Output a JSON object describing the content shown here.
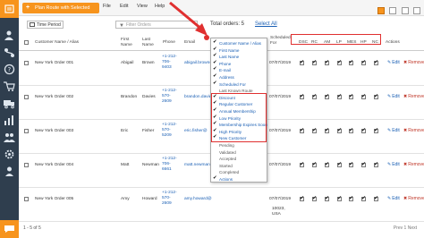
{
  "topbar": {
    "plan_button": "Plan Route with Selected",
    "menu": [
      "File",
      "Edit",
      "View",
      "Help"
    ]
  },
  "toolbar": {
    "time_period": "Time Period",
    "filter_placeholder": "Filter Orders",
    "total_orders": "Total orders: 5",
    "select_all": "Select All"
  },
  "table": {
    "headers": {
      "customer": "Customer Name / Alias",
      "first": "First Name",
      "last": "Last Name",
      "phone": "Phone",
      "email": "Email",
      "address": "Address",
      "scheduled": "Scheduled For",
      "actions": "Actions"
    },
    "flag_columns": [
      "DSC",
      "RC",
      "AM",
      "LP",
      "MES",
      "HP",
      "NC"
    ],
    "edit_label": "Edit",
    "remove_label": "Remove",
    "rows": [
      {
        "name": "New York Order 001",
        "first": "Abigail",
        "last": "Brown",
        "phone": "+1-212-706-9403",
        "email": "abigail.brown@",
        "scheduled": "07/07/2019",
        "flags": [
          true,
          true,
          true,
          true,
          true,
          true,
          true
        ]
      },
      {
        "name": "New York Order 002",
        "first": "Brandon",
        "last": "Davies",
        "phone": "+1-212-570-2609",
        "email": "brandon.davies@",
        "scheduled": "07/07/2019",
        "flags": [
          true,
          true,
          true,
          true,
          true,
          true,
          true
        ]
      },
      {
        "name": "New York Order 003",
        "first": "Eric",
        "last": "Fisher",
        "phone": "+1-212-570-5209",
        "email": "eric.fisher@",
        "scheduled": "07/07/2019",
        "flags": [
          true,
          true,
          true,
          true,
          true,
          true,
          true
        ]
      },
      {
        "name": "New York Order 004",
        "first": "Matt",
        "last": "Newman",
        "phone": "+1-212-706-6661",
        "email": "matt.newman@",
        "scheduled": "07/07/2019",
        "flags": [
          true,
          true,
          true,
          true,
          true,
          true,
          true
        ]
      },
      {
        "name": "New York Order 005",
        "first": "Amy",
        "last": "Howard",
        "phone": "+1-212-570-2609",
        "email": "amy.howard@",
        "scheduled": "07/07/2019",
        "address_tail": "10023, USA",
        "flags": [
          true,
          true,
          true,
          true,
          true,
          true,
          true
        ]
      }
    ]
  },
  "dropdown": {
    "items": [
      {
        "label": "Customer Name / Alias",
        "checked": true
      },
      {
        "label": "First Name",
        "checked": true
      },
      {
        "label": "Last Name",
        "checked": true
      },
      {
        "label": "Phone",
        "checked": true
      },
      {
        "label": "E-mail",
        "checked": true
      },
      {
        "label": "Address",
        "checked": true
      },
      {
        "label": "Scheduled For",
        "checked": true
      },
      {
        "label": "Last Known Route",
        "checked": false
      },
      {
        "label": "Discount",
        "checked": true
      },
      {
        "label": "Regular Customer",
        "checked": true
      },
      {
        "label": "Annual Membership",
        "checked": true
      },
      {
        "label": "Low Priority",
        "checked": true
      },
      {
        "label": "Membership Expires Soon",
        "checked": true
      },
      {
        "label": "High Priority",
        "checked": true
      },
      {
        "label": "New Customer",
        "checked": true
      },
      {
        "label": "Pending",
        "checked": false
      },
      {
        "label": "Validated",
        "checked": false
      },
      {
        "label": "Accepted",
        "checked": false
      },
      {
        "label": "Started",
        "checked": false
      },
      {
        "label": "Completed",
        "checked": false
      },
      {
        "label": "Actions",
        "checked": true
      }
    ]
  },
  "footer": {
    "paging": "1 - 5 of 5",
    "right": "Prev  1  Next"
  },
  "colors": {
    "accent": "#f7941d",
    "sidebar": "#2f3e4e",
    "highlight": "#e03030",
    "link": "#1a5fb4"
  }
}
